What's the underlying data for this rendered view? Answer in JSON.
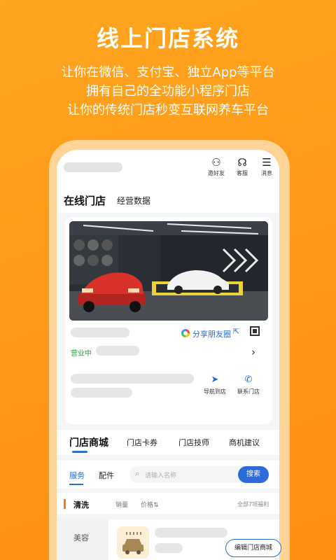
{
  "promo": {
    "title": "线上门店系统",
    "lines": [
      "让你在微信、支付宝、独立App等平台",
      "拥有自己的全功能小程序门店",
      "让你的传统门店秒变互联网养车平台"
    ]
  },
  "topbar": {
    "icons": [
      {
        "name": "invite-icon",
        "glyph": "⚇",
        "label": "邀好友"
      },
      {
        "name": "headset-icon",
        "glyph": "☊",
        "label": "客服"
      },
      {
        "name": "message-icon",
        "glyph": "☰",
        "label": "消息"
      }
    ]
  },
  "tabs": {
    "online_store": "在线门店",
    "business_data": "经营数据"
  },
  "store_card": {
    "share_label": "分享朋友圈",
    "share_ext_glyph": "⇱",
    "status": "营业中",
    "chevron": "›",
    "actions": [
      {
        "name": "navigate-button",
        "glyph": "➤",
        "label": "导航到店"
      },
      {
        "name": "contact-button",
        "glyph": "✆",
        "label": "联系门店"
      }
    ]
  },
  "mall_tabs": [
    "门店商城",
    "门店卡券",
    "门店技师",
    "商机建议"
  ],
  "filter": {
    "segments": [
      "服务",
      "配件"
    ],
    "search_placeholder": "请输入名称",
    "search_button": "搜索"
  },
  "sort": {
    "category": "清洗",
    "items": [
      "销量",
      "价格⇅"
    ],
    "total": "全部7项福利"
  },
  "left_categories": [
    "美容"
  ],
  "edit_mall_button": "编辑门店商城",
  "colors": {
    "accent": "#2c6bd8",
    "brand_orange": "#ff9a1a",
    "status_green": "#2c9b3d"
  }
}
